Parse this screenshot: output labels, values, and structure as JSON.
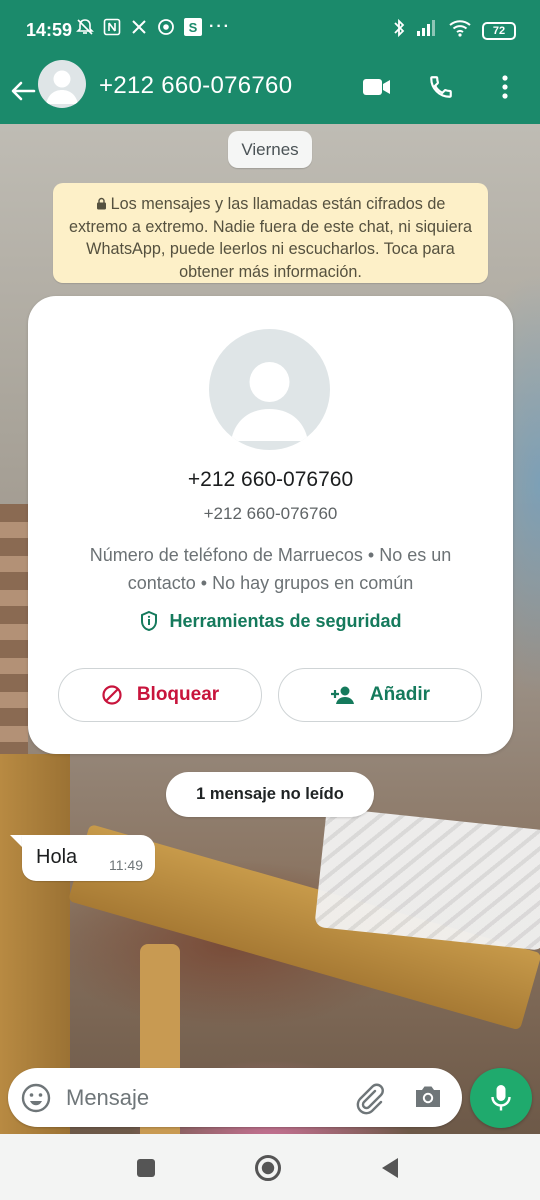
{
  "status_bar": {
    "time": "14:59",
    "battery": "72",
    "left_icons": [
      "bell-muted-icon",
      "nfc-icon",
      "x-icon",
      "chrome-icon",
      "s-icon"
    ],
    "right_icons": [
      "bluetooth-icon",
      "signal-icon",
      "wifi-icon",
      "battery-icon"
    ],
    "more": "···"
  },
  "header": {
    "title": "+212 660-076760",
    "bg_color": "#1b8a6b",
    "actions": [
      "video-call-icon",
      "voice-call-icon",
      "more-vert-icon"
    ]
  },
  "chat": {
    "date_chip": "Viernes",
    "encryption_notice": "Los mensajes y las llamadas están cifrados de extremo a extremo. Nadie fuera de este chat, ni siquiera WhatsApp, puede leerlos ni escucharlos. Toca para obtener más información.",
    "contact_card": {
      "name": "+212 660-076760",
      "subtitle": "+212 660-076760",
      "info": "Número de teléfono de Marruecos • No es un contacto • No hay grupos en común",
      "safety_tools": "Herramientas de seguridad",
      "block_label": "Bloquear",
      "add_label": "Añadir",
      "block_color": "#c8143c",
      "accent_color": "#157a5c"
    },
    "unread_chip": "1 mensaje no leído",
    "messages": [
      {
        "text": "Hola",
        "time": "11:49",
        "direction": "incoming"
      }
    ]
  },
  "composer": {
    "placeholder": "Mensaje",
    "mic_color": "#1faa6d"
  },
  "nav": {
    "buttons": [
      "recents-square-icon",
      "home-circle-icon",
      "back-triangle-icon"
    ]
  }
}
